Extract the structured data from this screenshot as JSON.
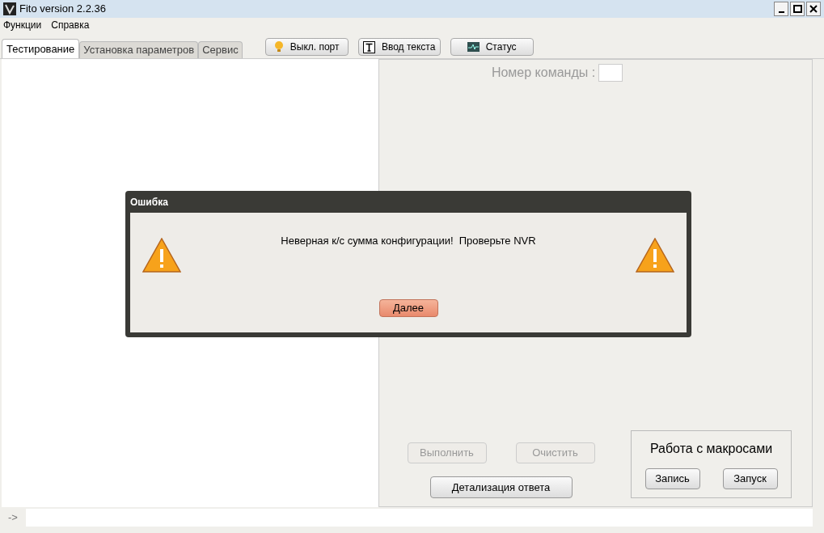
{
  "window": {
    "title": "Fito version 2.2.36"
  },
  "menu": [
    "Функции",
    "Справка"
  ],
  "tabs": [
    {
      "label": "Тестирование",
      "selected": true
    },
    {
      "label": "Установка параметров",
      "selected": false
    },
    {
      "label": "Сервис",
      "selected": false
    }
  ],
  "toolbar": [
    {
      "kind": "bulb",
      "label": "Выкл. порт"
    },
    {
      "kind": "text",
      "label": "Ввод текста"
    },
    {
      "kind": "monitor",
      "label": "Статус"
    }
  ],
  "command_number": {
    "label": "Номер команды :"
  },
  "actions": [
    {
      "label": "Выполнить",
      "disabled": true
    },
    {
      "label": "Очистить",
      "disabled": true
    }
  ],
  "details_button": "Детализация ответа",
  "macros": {
    "title": "Работа с макросами",
    "buttons": [
      "Запись",
      "Запуск"
    ]
  },
  "prompt": "->",
  "dialog": {
    "title": "Ошибка",
    "message": "Неверная к/с сумма конфигурации!  Проверьте NVR",
    "button": "Далее"
  }
}
